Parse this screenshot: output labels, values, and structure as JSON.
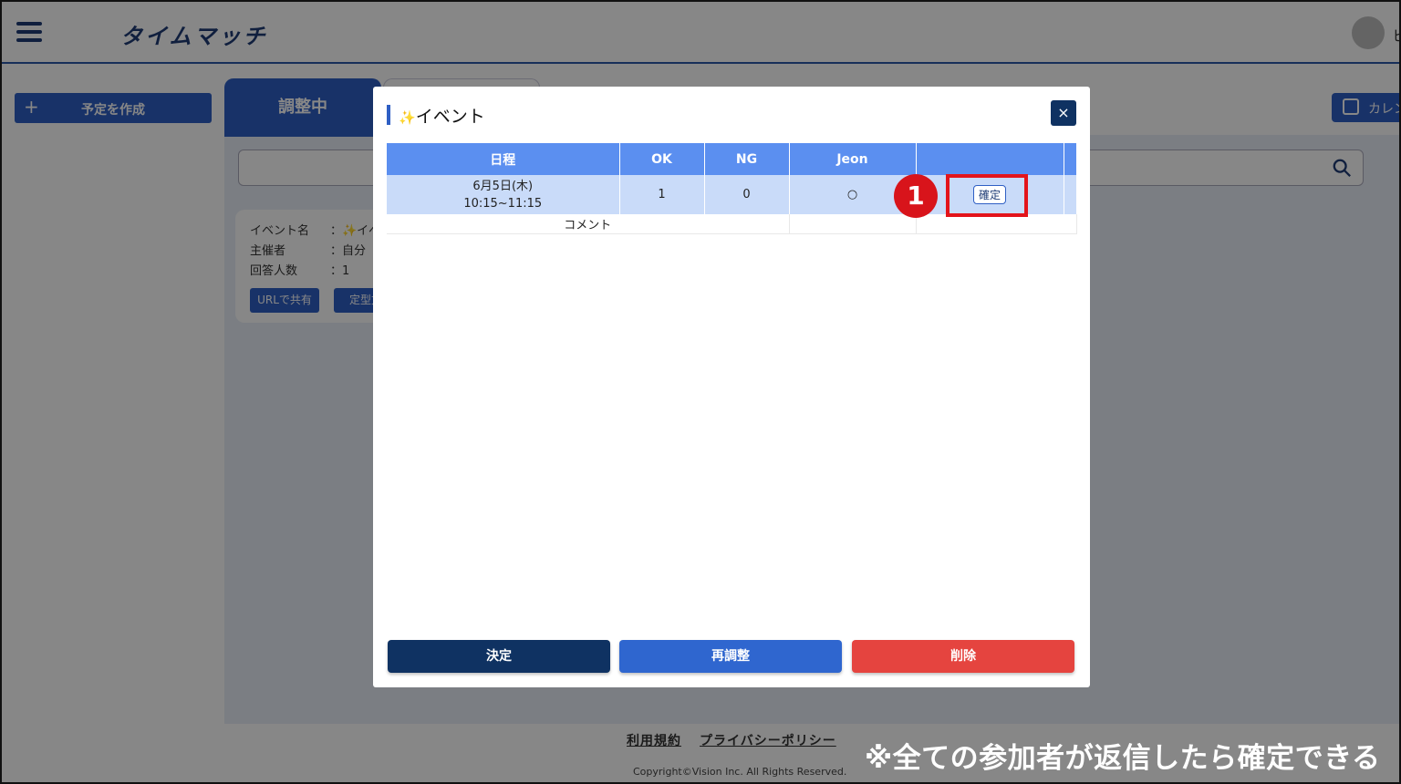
{
  "header": {
    "logo": "タイムマッチ",
    "user_initial": "ヒ"
  },
  "sidebar": {
    "create_button": "予定を作成"
  },
  "main": {
    "tab_active": "調整中",
    "calendar_button": "カレン",
    "event_card": {
      "rows": [
        {
          "key": "イベント名",
          "value": "：✨イベ"
        },
        {
          "key": "主催者",
          "value": "：自分"
        },
        {
          "key": "回答人数",
          "value": "：1"
        }
      ],
      "share_url_button": "URLで共有",
      "template_button": "定型文"
    }
  },
  "modal": {
    "title_icon": "✨",
    "title": "イベント",
    "close_label": "×",
    "table": {
      "headers": [
        "日程",
        "OK",
        "NG",
        "Jeon",
        ""
      ],
      "slot": {
        "date": "6月5日(木)",
        "time": "10:15~11:15",
        "ok": "1",
        "ng": "0",
        "jeon": "○",
        "confirm_button": "確定"
      },
      "comment_label": "コメント"
    },
    "buttons": {
      "decide": "決定",
      "readjust": "再調整",
      "delete": "削除"
    },
    "step_marker": "1"
  },
  "footer": {
    "terms": "利用規約",
    "privacy": "プライバシーポリシー",
    "copyright": "Copyright©Vision Inc. All Rights Reserved."
  },
  "caption": "※全ての参加者が返信したら確定できる",
  "colors": {
    "primary": "#2f5fc4",
    "navy": "#0f3262",
    "table_header": "#5b8ff0",
    "slot_row": "#c9dbf9",
    "delete": "#e5443f",
    "highlight": "#e3141b"
  }
}
